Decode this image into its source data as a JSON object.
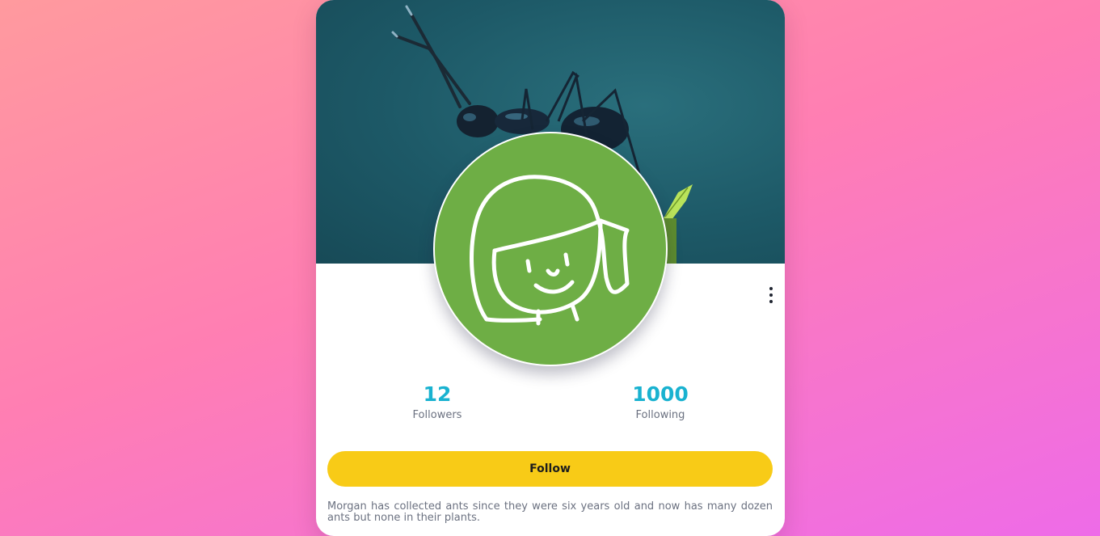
{
  "card": {
    "cover_image": "ant-photo",
    "avatar_image": "cartoon-girl-avatar",
    "menu_icon": "more-vertical-icon"
  },
  "stats": [
    {
      "value": "12",
      "label": "Followers"
    },
    {
      "value": "1000",
      "label": "Following"
    }
  ],
  "follow_button": {
    "label": "Follow"
  },
  "bio": "Morgan has collected ants since they were six years old and now has many dozen ants but none in their plants.",
  "colors": {
    "background_start": "#ff9a9e",
    "background_end": "#ee6be8",
    "accent": "#19b2d0",
    "button": "#f8cb17",
    "avatar_bg": "#6eae45",
    "cover_bg": "#1d5967"
  }
}
